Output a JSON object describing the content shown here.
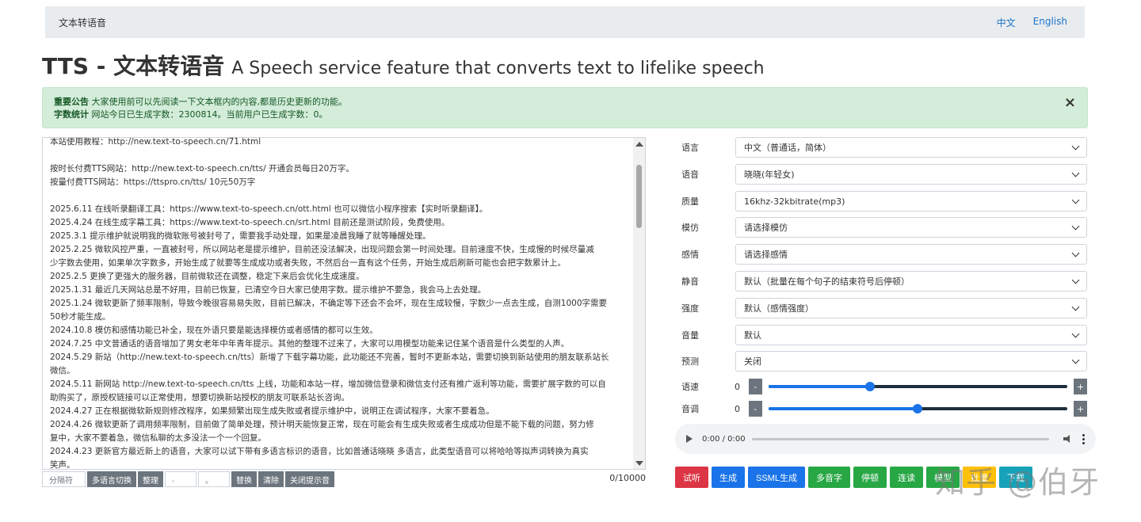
{
  "navbar": {
    "brand": "文本转语音",
    "lang_zh": "中文",
    "lang_en": "English"
  },
  "heading": {
    "main": "TTS - 文本转语音",
    "sub": "A Speech service feature that converts text to lifelike speech"
  },
  "alert": {
    "line1_label": "重要公告",
    "line1_text": "大家使用前可以先阅读一下文本框内的内容,都是历史更新的功能。",
    "line2_label": "字数统计",
    "line2_text": "网站今日已生成字数：2300814。当前用户已生成字数：0。",
    "close": "×"
  },
  "textarea": {
    "lines": [
      "本站使用教程：http://new.text-to-speech.cn/71.html",
      "",
      "按时长付费TTS网站：http://new.text-to-speech.cn/tts/  开通会员每日20万字。",
      "按量付费TTS网站：https://ttspro.cn/tts/  10元50万字",
      "",
      "2025.6.11 在线听录翻译工具：https://www.text-to-speech.cn/ott.html 也可以微信小程序搜索【实时听录翻译】。",
      "2025.4.24 在线生成字幕工具：https://www.text-to-speech.cn/srt.html 目前还是测试阶段，免费使用。",
      "2025.3.1 提示维护就说明我的微软账号被封号了，需要我手动处理，如果是凌晨我睡了就等睡醒处理。",
      "2025.2.25 微软风控严重，一直被封号，所以网站老是提示维护，目前还没法解决，出现问题会第一时间处理。目前速度不快，生成慢的时候尽量减",
      "少字数去使用，如果单次字数多，开始生成了就要等生成成功或者失败，不然后台一直有这个任务，开始生成后刷新可能也会把字数累计上。",
      "2025.2.5 更换了更强大的服务器，目前微软还在调整，稳定下来后会优化生成速度。",
      "2025.1.31 最近几天网站总是不好用，目前已恢复，已清空今日大家已使用字数。提示维护不要急，我会马上去处理。",
      "2025.1.24 微软更新了频率限制，导致今晚很容易易失败，目前已解决，不确定等下还会不会坏，现在生成较慢，字数少一点去生成，自测1000字需要",
      "50秒才能生成。",
      "2024.10.8 模仿和感情功能已补全，现在外语只要是能选择模仿或者感情的都可以生效。",
      "2024.7.25 中文普通话的语音增加了男女老年中年青年提示。其他的整理不过来了，大家可以用模型功能来记住某个语音是什么类型的人声。",
      "2024.5.29 新站（http://new.text-to-speech.cn/tts）新增了下载字幕功能，此功能还不完善，暂时不更新本站，需要切换到新站使用的朋友联系站长",
      "微信。",
      "2024.5.11 新网站 http://new.text-to-speech.cn/tts 上线，功能和本站一样，增加微信登录和微信支付还有推广返利等功能，需要扩展字数的可以自",
      "助购买了，原授权链接可以正常使用，想要切换新站授权的朋友可联系站长咨询。",
      "2024.4.27 正在根据微软新规则修改程序，如果频繁出现生成失败或者提示维护中，说明正在调试程序，大家不要着急。",
      "2024.4.26 微软更新了调用频率限制，目前做了简单处理，预计明天能恢复正常，现在可能会有生成失败或者生成成功但是不能下载的问题，努力修",
      "复中，大家不要着急，微信私聊的太多没法一个一个回复。",
      "2024.4.23 更新官方最近新上的语音，大家可以试下带有多语言标识的语音，比如普通话晓晓 多语言，此类型语音可以将哈哈等拟声词转换为真实",
      "笑声。"
    ]
  },
  "toolbar": {
    "separator_placeholder": "分隔符",
    "multi_lang": "多语言切换",
    "tidy": "整理",
    "find_value": ".",
    "replace_value": "。",
    "replace": "替换",
    "clear": "清除",
    "close_tip": "关闭提示音",
    "counter": "0/10000"
  },
  "form": {
    "language": {
      "label": "语言",
      "value": "中文（普通话，简体）"
    },
    "voice": {
      "label": "语音",
      "value": "晓晓(年轻女)"
    },
    "quality": {
      "label": "质量",
      "value": "16khz-32kbitrate(mp3)"
    },
    "imitate": {
      "label": "模仿",
      "value": "请选择模仿"
    },
    "emotion": {
      "label": "感情",
      "value": "请选择感情"
    },
    "silence": {
      "label": "静音",
      "value": "默认（批量在每个句子的结束符号后停顿）"
    },
    "intensity": {
      "label": "强度",
      "value": "默认（感情强度）"
    },
    "volume": {
      "label": "音量",
      "value": "默认"
    },
    "preview": {
      "label": "预测",
      "value": "关闭"
    }
  },
  "sliders": {
    "speed": {
      "label": "语速",
      "value": "0",
      "minus": "-",
      "plus": "+",
      "fraction": 0.34
    },
    "pitch": {
      "label": "音调",
      "value": "0",
      "minus": "-",
      "plus": "+",
      "fraction": 0.5
    }
  },
  "audio": {
    "time": "0:00 / 0:00"
  },
  "actions": [
    {
      "name": "listen-button",
      "label": "试听",
      "color": "#dc3545"
    },
    {
      "name": "generate-button",
      "label": "生成",
      "color": "#1a73e8"
    },
    {
      "name": "ssml-generate-button",
      "label": "SSML生成",
      "color": "#1a73e8"
    },
    {
      "name": "polyphone-button",
      "label": "多音字",
      "color": "#28a745"
    },
    {
      "name": "pause-button",
      "label": "停顿",
      "color": "#28a745"
    },
    {
      "name": "liaison-button",
      "label": "连读",
      "color": "#28a745"
    },
    {
      "name": "model-button",
      "label": "模型",
      "color": "#28a745"
    },
    {
      "name": "batch-button",
      "label": "批量",
      "color": "#ffc107"
    },
    {
      "name": "download-button",
      "label": "下载",
      "color": "#17a2b8"
    }
  ],
  "watermark": "知乎 @伯牙"
}
